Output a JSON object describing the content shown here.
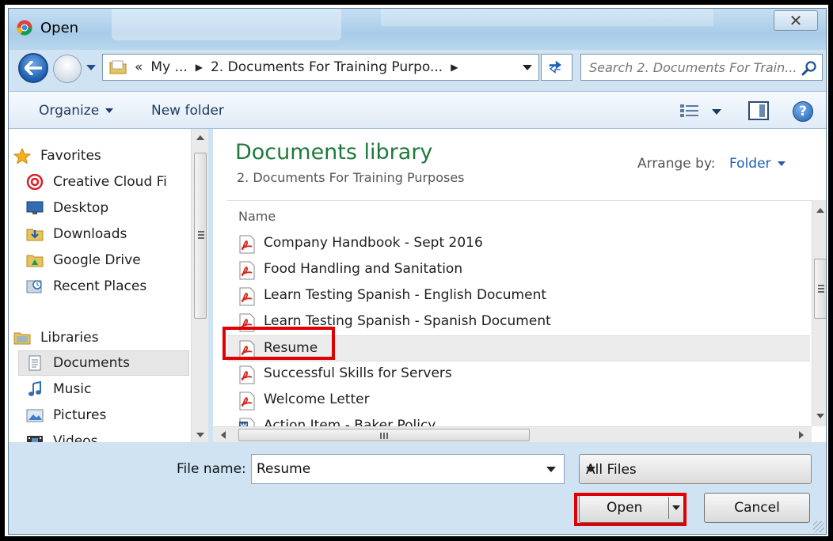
{
  "window": {
    "title": "Open",
    "close_glyph": "✕"
  },
  "address": {
    "overflow": "«",
    "segments": [
      "My ...",
      "2. Documents For Training Purpo..."
    ],
    "search_placeholder": "Search 2. Documents For Train..."
  },
  "toolbar": {
    "organize": "Organize",
    "new_folder": "New folder",
    "help": "?"
  },
  "nav": {
    "favorites": {
      "label": "Favorites",
      "items": [
        "Creative Cloud Fi",
        "Desktop",
        "Downloads",
        "Google Drive",
        "Recent Places"
      ]
    },
    "libraries": {
      "label": "Libraries",
      "items": [
        "Documents",
        "Music",
        "Pictures",
        "Videos"
      ],
      "selected": "Documents"
    }
  },
  "content": {
    "library_title": "Documents library",
    "library_subtitle": "2. Documents For Training Purposes",
    "arrange_label": "Arrange by:",
    "arrange_value": "Folder",
    "column_name": "Name",
    "files": [
      {
        "name": "Company Handbook - Sept 2016",
        "icon": "pdf-icon"
      },
      {
        "name": "Food Handling and Sanitation",
        "icon": "pdf-icon"
      },
      {
        "name": "Learn Testing Spanish - English Document",
        "icon": "pdf-icon"
      },
      {
        "name": "Learn Testing Spanish - Spanish Document",
        "icon": "pdf-icon"
      },
      {
        "name": "Resume",
        "icon": "pdf-icon"
      },
      {
        "name": "Successful Skills for Servers",
        "icon": "pdf-icon"
      },
      {
        "name": "Welcome Letter",
        "icon": "pdf-icon"
      },
      {
        "name": "Action Item - Baker Policy",
        "icon": "word-icon"
      }
    ],
    "selected_file": "Resume"
  },
  "bottom": {
    "file_name_label": "File name:",
    "file_name_value": "Resume",
    "file_type": "All Files",
    "open_label": "Open",
    "cancel_label": "Cancel"
  },
  "colors": {
    "library_title": "#1d7a3a",
    "highlight": "#e00000",
    "link": "#1d5fb2"
  }
}
